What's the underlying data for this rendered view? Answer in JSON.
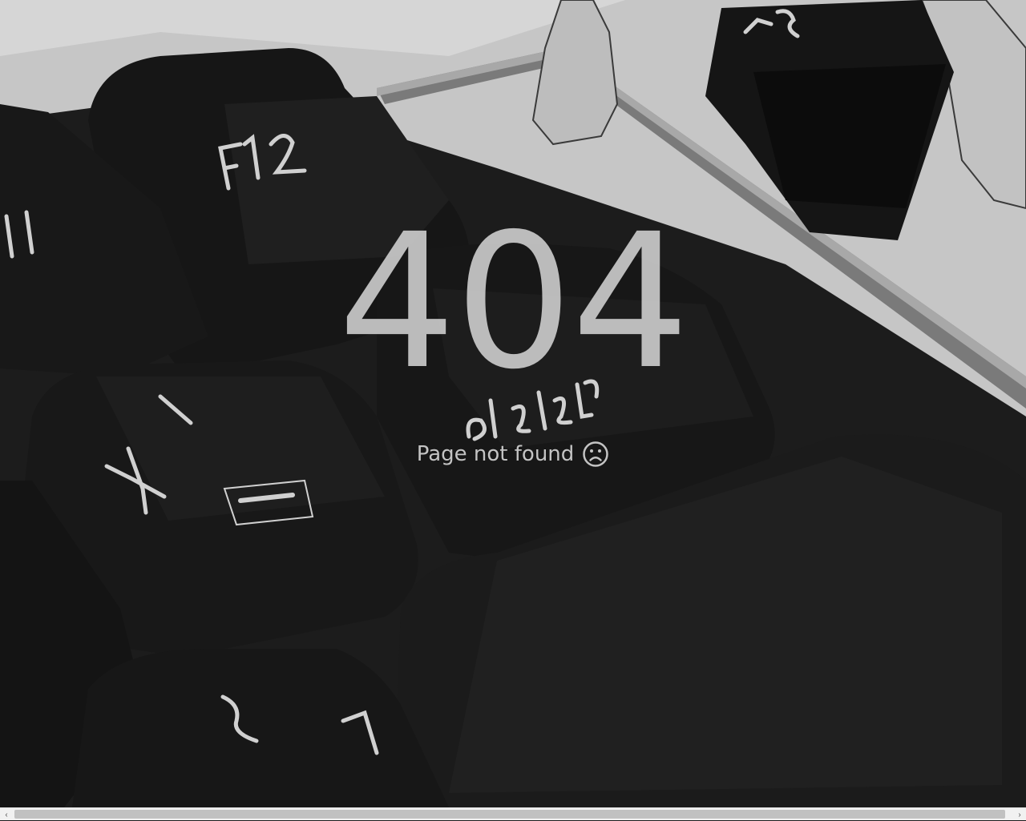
{
  "error": {
    "code": "404",
    "message": "Page not found",
    "icon": "frown-icon"
  },
  "background": {
    "subject": "keyboard-photo",
    "key_labels": [
      "F12",
      "delete",
      "11",
      "F13"
    ]
  },
  "scrollbar": {
    "orientation": "horizontal",
    "left_arrow": "‹",
    "right_arrow": "›"
  },
  "colors": {
    "background_dark": "#1c1c1c",
    "surface_light": "#c8c8c8",
    "text": "#c4c4c4"
  }
}
